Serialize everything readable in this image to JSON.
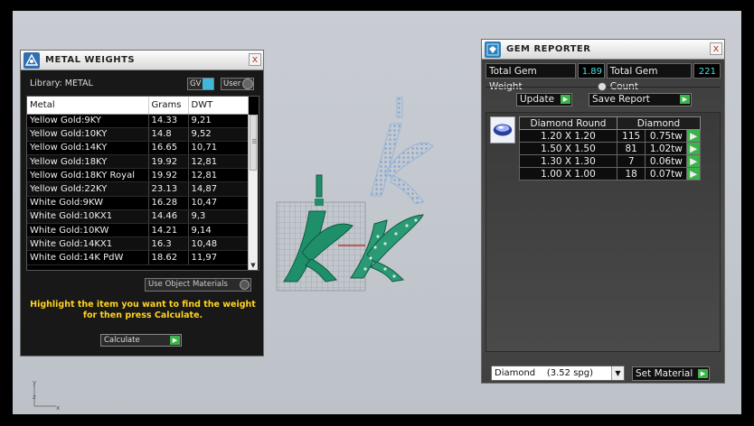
{
  "metal_weights": {
    "title": "METAL WEIGHTS",
    "library_label": "Library: METAL",
    "gv_label": "GV",
    "user_label": "User",
    "columns": [
      "Metal",
      "Grams",
      "DWT"
    ],
    "rows": [
      [
        "Yellow Gold:9KY",
        "14.33",
        "9,21"
      ],
      [
        "Yellow Gold:10KY",
        "14.8",
        "9,52"
      ],
      [
        "Yellow Gold:14KY",
        "16.65",
        "10,71"
      ],
      [
        "Yellow Gold:18KY",
        "19.92",
        "12,81"
      ],
      [
        "Yellow Gold:18KY Royal",
        "19.92",
        "12,81"
      ],
      [
        "Yellow Gold:22KY",
        "23.13",
        "14,87"
      ],
      [
        "White Gold:9KW",
        "16.28",
        "10,47"
      ],
      [
        "White Gold:10KX1",
        "14.46",
        "9,3"
      ],
      [
        "White Gold:10KW",
        "14.21",
        "9,14"
      ],
      [
        "White Gold:14KX1",
        "16.3",
        "10,48"
      ],
      [
        "White Gold:14K PdW",
        "18.62",
        "11,97"
      ]
    ],
    "use_object_materials": "Use Object Materials",
    "hint_line1": "Highlight the item you want to find the weight",
    "hint_line2": "for then press Calculate.",
    "calculate_label": "Calculate",
    "close_glyph": "x"
  },
  "gem_reporter": {
    "title": "GEM REPORTER",
    "total_gem_weight_label": "Total Gem Weight",
    "total_gem_weight_value": "1.89",
    "total_gem_count_label": "Total Gem Count",
    "total_gem_count_value": "221",
    "update_label": "Update",
    "save_report_label": "Save Report",
    "table_headers": [
      "Diamond Round",
      "Diamond"
    ],
    "rows": [
      [
        "1.20 X 1.20",
        "115",
        "0.75tw"
      ],
      [
        "1.50 X 1.50",
        "81",
        "1.02tw"
      ],
      [
        "1.30 X 1.30",
        "7",
        "0.06tw"
      ],
      [
        "1.00 X 1.00",
        "18",
        "0.07tw"
      ]
    ],
    "material_select": "Diamond    (3.52 spg)",
    "set_material_label": "Set Material",
    "close_glyph": "x"
  },
  "axis": {
    "x": "x",
    "y": "y",
    "z": "z"
  },
  "colors": {
    "gem_model": "#1f8f6a",
    "wire_model": "#8fb2dc",
    "go_button": "#3cb34a",
    "hint_text": "#ffd21f",
    "stat_value": "#4de0e0"
  }
}
